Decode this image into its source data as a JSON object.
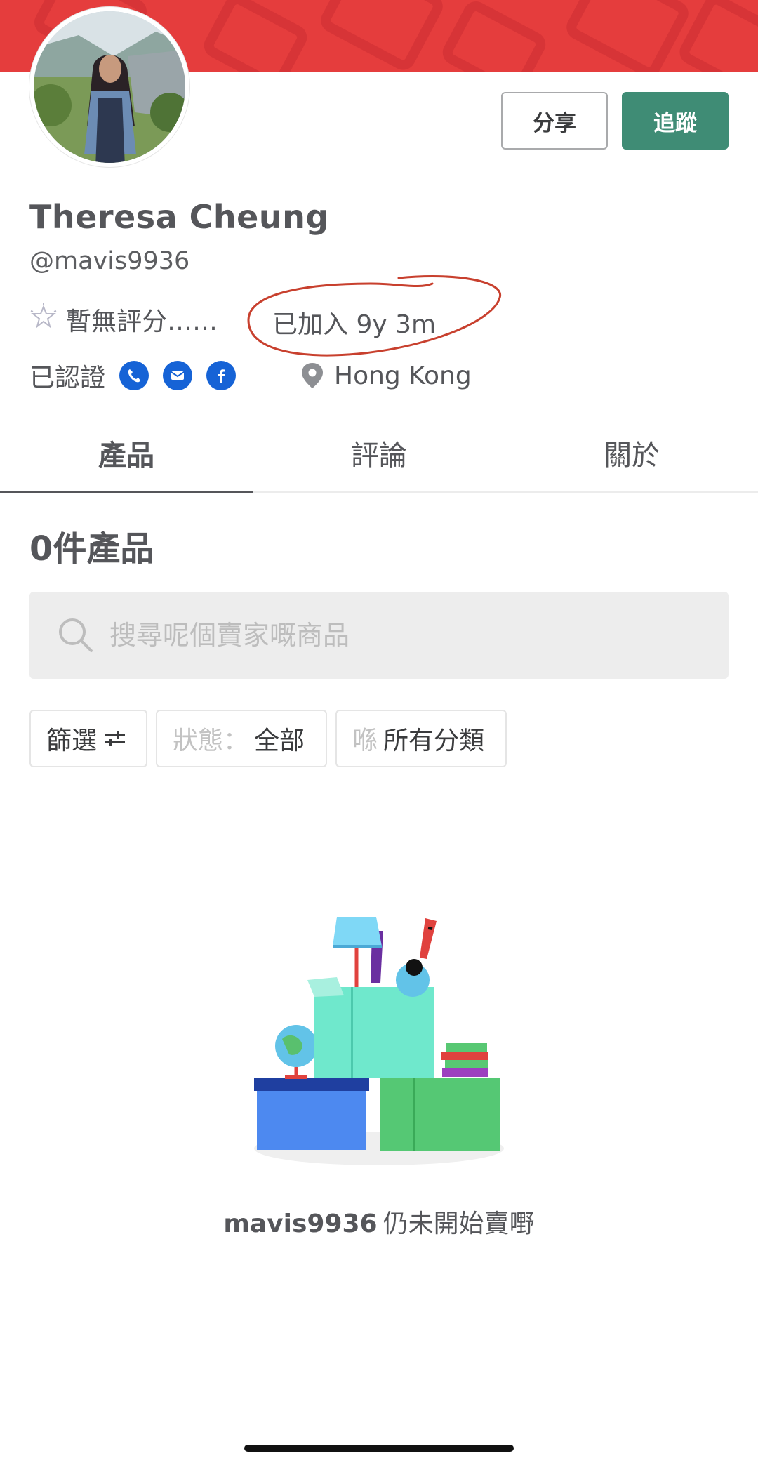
{
  "profile": {
    "name": "Theresa Cheung",
    "handle": "@mavis9936",
    "rating_text": "暫無評分……",
    "joined_text": "已加入 9y 3m",
    "verified_label": "已認證",
    "verified_icons": [
      "phone-icon",
      "email-icon",
      "facebook-icon"
    ],
    "location": "Hong Kong"
  },
  "actions": {
    "share_label": "分享",
    "follow_label": "追蹤"
  },
  "tabs": [
    {
      "label": "產品",
      "active": true
    },
    {
      "label": "評論",
      "active": false
    },
    {
      "label": "關於",
      "active": false
    }
  ],
  "listings": {
    "count_text": "0件產品",
    "search_placeholder": "搜尋呢個賣家嘅商品",
    "filter_label": "篩選",
    "status_prefix": "狀態：",
    "status_value": "全部",
    "category_prefix": "喺",
    "category_value": "所有分類",
    "empty_username": "mavis9936",
    "empty_text": "仍未開始賣嘢"
  },
  "colors": {
    "cover": "#e53d3d",
    "follow_button": "#3f8c75",
    "verified_icon": "#1663d6",
    "text": "#55565a",
    "annotation": "#c8402e"
  }
}
